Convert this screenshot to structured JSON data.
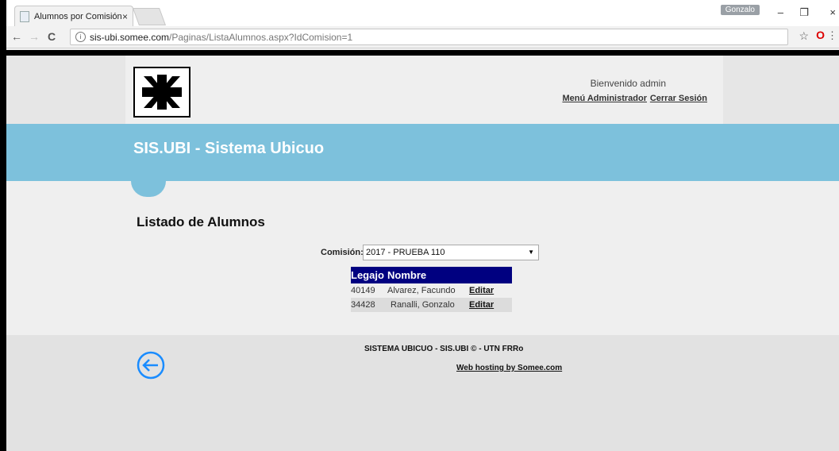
{
  "browser": {
    "tab_title": "Alumnos por Comisión",
    "tab_close": "×",
    "profile_name": "Gonzalo",
    "url_host": "sis-ubi.somee.com",
    "url_path": "/Paginas/ListaAlumnos.aspx?IdComision=1",
    "icons": {
      "back": "←",
      "forward": "→",
      "reload": "C",
      "info": "i",
      "star": "☆",
      "opera": "O",
      "menu": "⋮",
      "minimize": "–",
      "restore": "❐",
      "close": "×"
    }
  },
  "header": {
    "welcome_text": "Bienvenido admin",
    "admin_menu_link": "Menú Administrador",
    "logout_link": "Cerrar Sesión"
  },
  "banner": {
    "title": "SIS.UBI - Sistema Ubicuo"
  },
  "main": {
    "page_title": "Listado de Alumnos",
    "commission_label": "Comisión:",
    "commission_selected": "2017 - PRUEBA 110",
    "table": {
      "headers": [
        "Legajo",
        "Nombre"
      ],
      "rows": [
        {
          "legajo": "40149",
          "nombre": "Alvarez, Facundo",
          "action": "Editar"
        },
        {
          "legajo": "34428",
          "nombre": "Ranalli, Gonzalo",
          "action": "Editar"
        }
      ]
    }
  },
  "footer": {
    "title": "SISTEMA UBICUO - SIS.UBI © - UTN FRRo",
    "hosting_link": "Web hosting by Somee.com"
  },
  "colors": {
    "banner": "#7dc1dc",
    "table_header": "#000080",
    "back_icon": "#1a8cff"
  }
}
